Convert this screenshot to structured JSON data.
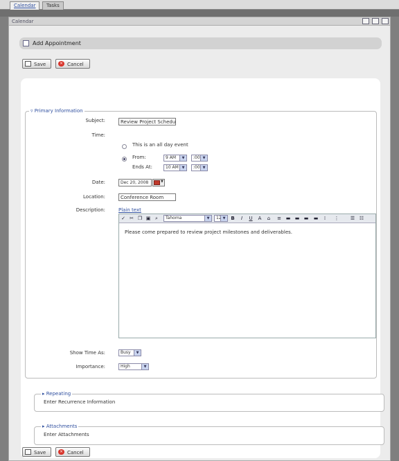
{
  "tabs": [
    {
      "label": "Calendar",
      "active": true
    },
    {
      "label": "Tasks",
      "active": false
    }
  ],
  "portlet": {
    "title": "Calendar"
  },
  "page": {
    "title": "Add Appointment"
  },
  "buttons": {
    "save": "Save",
    "cancel": "Cancel"
  },
  "sections": {
    "primary": "Primary Information",
    "repeating": {
      "title": "Repeating",
      "text": "Enter Recurrence Information"
    },
    "attachments": {
      "title": "Attachments",
      "text": "Enter Attachments"
    }
  },
  "form": {
    "subject": {
      "label": "Subject:",
      "value": "Review Project Schedu"
    },
    "time": {
      "label": "Time:",
      "all_day_label": "This is an all day event",
      "from_label": "From:",
      "from_hour": "9 AM",
      "from_min": ":00",
      "ends_label": "Ends At:",
      "ends_hour": "10 AM",
      "ends_min": ":00",
      "selected": "from"
    },
    "date": {
      "label": "Date:",
      "value": "Dec 20, 2008"
    },
    "location": {
      "label": "Location:",
      "value": "Conference Room"
    },
    "description": {
      "label": "Description:",
      "plain_text_link": "Plain text",
      "font": "Tahoma",
      "size": "12",
      "body": "Please come prepared to review project milestones and deliverables."
    },
    "show_time_as": {
      "label": "Show Time As:",
      "value": "Busy"
    },
    "importance": {
      "label": "Importance:",
      "value": "High"
    }
  },
  "icons": {
    "calendar": "calendar-icon",
    "save": "save-icon",
    "cancel": "cancel-icon",
    "collapse": "triangle-down-icon",
    "expand": "triangle-right-icon"
  },
  "colors": {
    "link": "#2f4f9f",
    "cancel": "#d8342b",
    "chrome": "#7f7f7f"
  }
}
